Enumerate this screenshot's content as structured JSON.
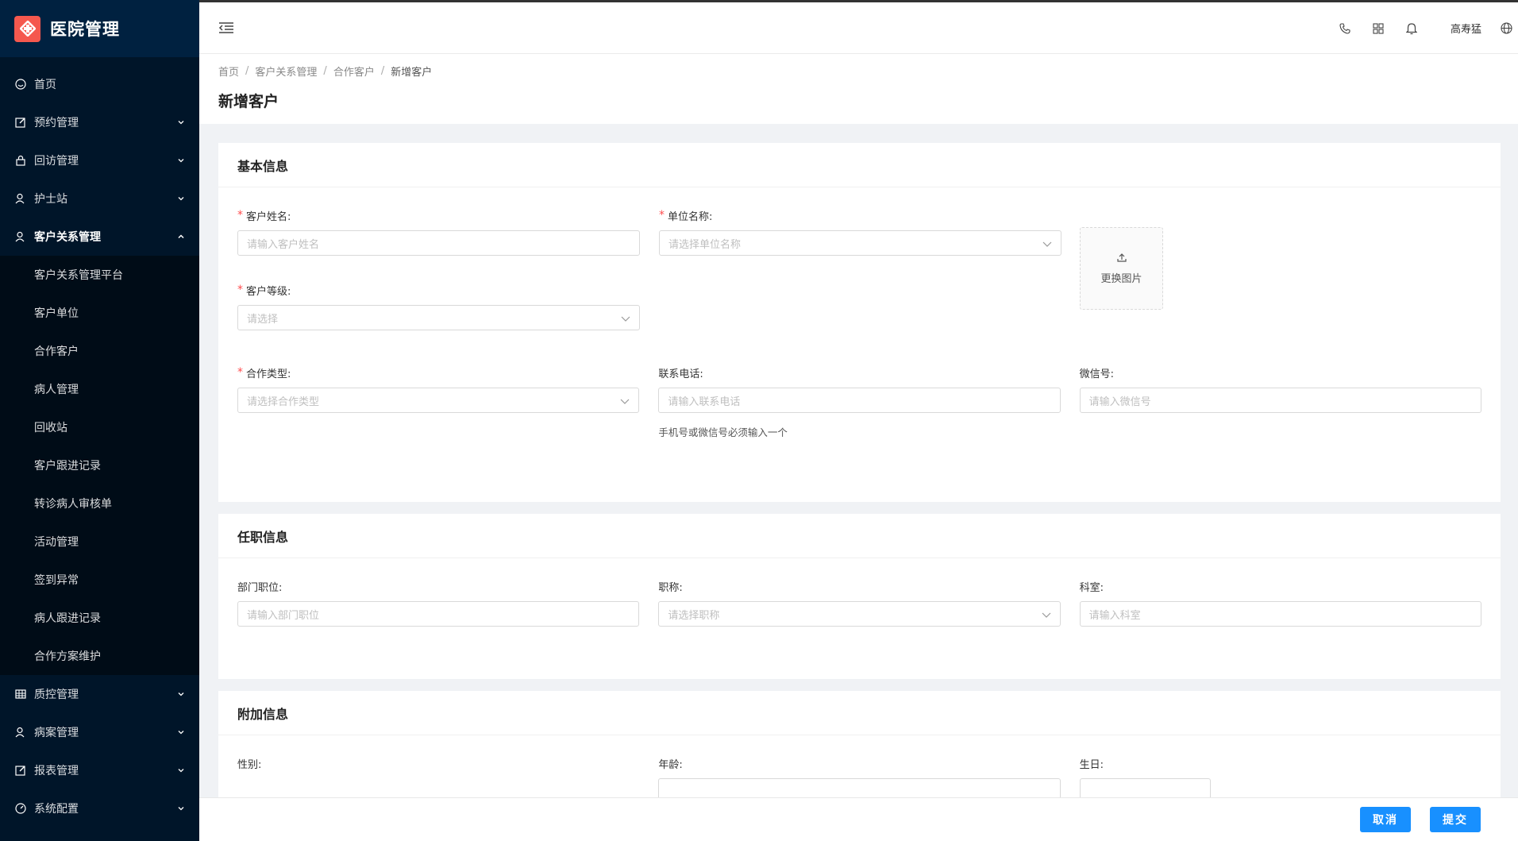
{
  "app": {
    "title": "医院管理"
  },
  "sidebar": {
    "items": [
      {
        "label": "首页",
        "icon": "dashboard-icon"
      },
      {
        "label": "预约管理",
        "icon": "edit-icon"
      },
      {
        "label": "回访管理",
        "icon": "lock-icon"
      },
      {
        "label": "护士站",
        "icon": "user-icon"
      },
      {
        "label": "客户关系管理",
        "icon": "user-icon",
        "expanded": true
      }
    ],
    "subitems": [
      "客户关系管理平台",
      "客户单位",
      "合作客户",
      "病人管理",
      "回收站",
      "客户跟进记录",
      "转诊病人审核单",
      "活动管理",
      "签到异常",
      "病人跟进记录",
      "合作方案维护"
    ],
    "bottom_items": [
      {
        "label": "质控管理",
        "icon": "table-icon"
      },
      {
        "label": "病案管理",
        "icon": "user-icon"
      },
      {
        "label": "报表管理",
        "icon": "edit-icon"
      },
      {
        "label": "系统配置",
        "icon": "dashboard-icon"
      }
    ]
  },
  "header": {
    "user_name": "高寿猛"
  },
  "breadcrumb": [
    "首页",
    "客户关系管理",
    "合作客户",
    "新增客户"
  ],
  "page_title": "新增客户",
  "sections": {
    "basic": {
      "title": "基本信息",
      "customer_name": {
        "label": "客户姓名:",
        "placeholder": "请输入客户姓名"
      },
      "company_name": {
        "label": "单位名称:",
        "placeholder": "请选择单位名称"
      },
      "upload_label": "更换图片",
      "customer_level": {
        "label": "客户等级:",
        "placeholder": "请选择"
      },
      "coop_type": {
        "label": "合作类型:",
        "placeholder": "请选择合作类型"
      },
      "phone": {
        "label": "联系电话:",
        "placeholder": "请输入联系电话",
        "help": "手机号或微信号必须输入一个"
      },
      "wechat": {
        "label": "微信号:",
        "placeholder": "请输入微信号"
      }
    },
    "job": {
      "title": "任职信息",
      "dept_position": {
        "label": "部门职位:",
        "placeholder": "请输入部门职位"
      },
      "job_title": {
        "label": "职称:",
        "placeholder": "请选择职称"
      },
      "department": {
        "label": "科室:",
        "placeholder": "请输入科室"
      }
    },
    "extra": {
      "title": "附加信息",
      "gender": {
        "label": "性别:"
      },
      "age": {
        "label": "年龄:"
      },
      "birthday": {
        "label": "生日:"
      }
    }
  },
  "footer": {
    "cancel_label": "取消",
    "submit_label": "提交"
  },
  "colors": {
    "sidebar_bg": "#001529",
    "submenu_bg": "#000c17",
    "primary": "#1890ff",
    "required": "#ff4d4f",
    "logo": "#f5584e"
  }
}
